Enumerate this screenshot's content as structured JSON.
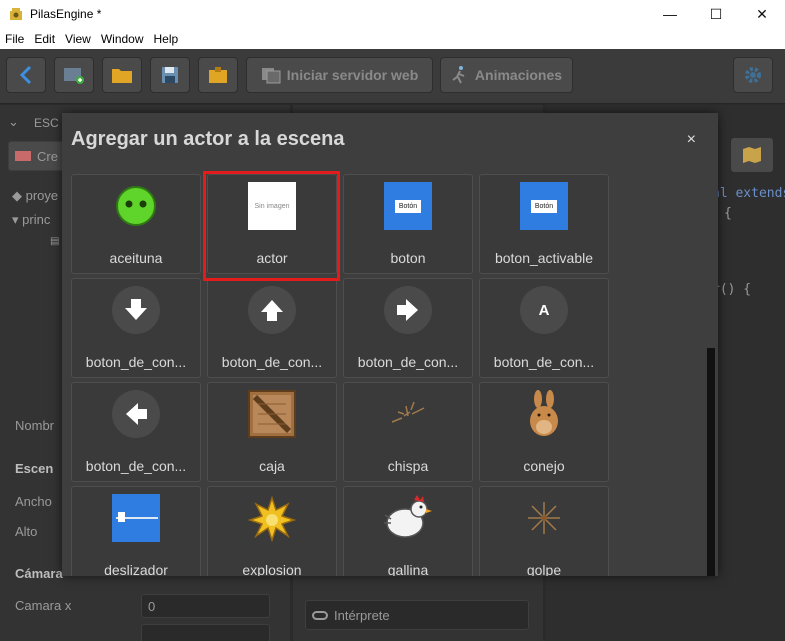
{
  "window": {
    "title": "PilasEngine *",
    "minimize": "—",
    "maximize": "☐",
    "close": "✕"
  },
  "menu": [
    "File",
    "Edit",
    "View",
    "Window",
    "Help"
  ],
  "toolbar": {
    "server_label": "Iniciar servidor web",
    "animations_label": "Animaciones"
  },
  "background": {
    "scene_tab": "ESC",
    "create_btn": "Cre",
    "tree": [
      "proye",
      "princ"
    ],
    "name_label": "Nombr",
    "scene_section": "Escen",
    "width_label": "Ancho",
    "height_label": "Alto",
    "camera_section": "Cámara",
    "camera_x_label": "Camara x",
    "camera_x_value": "0",
    "interpreter": "Intérprete",
    "code": [
      "al extends",
      "{",
      "r() {"
    ]
  },
  "dialog": {
    "title": "Agregar un actor a la escena",
    "close": "×",
    "selected": "actor",
    "actors": [
      {
        "label": "aceituna",
        "icon": "aceituna-icon"
      },
      {
        "label": "actor",
        "icon": "sin-imagen-icon",
        "thumb_text": "Sin imagen"
      },
      {
        "label": "boton",
        "icon": "boton-icon",
        "thumb_text": "Botón"
      },
      {
        "label": "boton_activable",
        "icon": "boton-activable-icon",
        "thumb_text": "Botón"
      },
      {
        "label": "boton_de_con...",
        "icon": "arrow-down-icon"
      },
      {
        "label": "boton_de_con...",
        "icon": "arrow-up-icon"
      },
      {
        "label": "boton_de_con...",
        "icon": "arrow-right-icon"
      },
      {
        "label": "boton_de_con...",
        "icon": "button-a-icon",
        "thumb_text": "A"
      },
      {
        "label": "boton_de_con...",
        "icon": "arrow-left-icon"
      },
      {
        "label": "caja",
        "icon": "wooden-box-icon"
      },
      {
        "label": "chispa",
        "icon": "spark-icon"
      },
      {
        "label": "conejo",
        "icon": "rabbit-icon"
      },
      {
        "label": "deslizador",
        "icon": "slider-icon"
      },
      {
        "label": "explosion",
        "icon": "explosion-icon"
      },
      {
        "label": "gallina",
        "icon": "chicken-icon"
      },
      {
        "label": "golpe",
        "icon": "hit-icon"
      }
    ]
  },
  "colors": {
    "accent_blue": "#2f7de1",
    "selection_red": "#e31b1b",
    "olive_green": "#5fd42a",
    "box_brown": "#a07040"
  }
}
